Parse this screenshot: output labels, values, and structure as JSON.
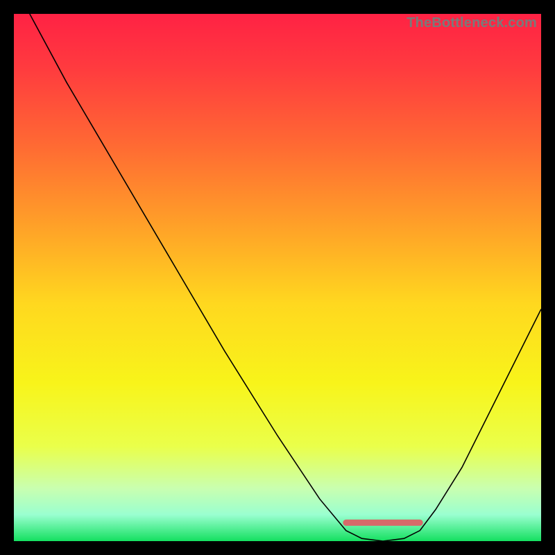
{
  "watermark": "TheBottleneck.com",
  "chart_data": {
    "type": "line",
    "title": "",
    "xlabel": "",
    "ylabel": "",
    "xlim": [
      0,
      100
    ],
    "ylim": [
      0,
      100
    ],
    "grid": false,
    "legend": false,
    "background_gradient": {
      "stops": [
        {
          "offset": 0.0,
          "color": "#ff2244"
        },
        {
          "offset": 0.1,
          "color": "#ff3a3f"
        },
        {
          "offset": 0.25,
          "color": "#ff6a33"
        },
        {
          "offset": 0.4,
          "color": "#ffa028"
        },
        {
          "offset": 0.55,
          "color": "#ffd81f"
        },
        {
          "offset": 0.7,
          "color": "#f8f41a"
        },
        {
          "offset": 0.82,
          "color": "#eaff4a"
        },
        {
          "offset": 0.9,
          "color": "#c9ffb0"
        },
        {
          "offset": 0.95,
          "color": "#9affd0"
        },
        {
          "offset": 1.0,
          "color": "#14e060"
        }
      ]
    },
    "series": [
      {
        "name": "bottleneck-curve",
        "color": "#000000",
        "width": 1.6,
        "x": [
          3,
          10,
          20,
          30,
          40,
          50,
          58,
          63,
          66,
          70,
          74,
          77,
          80,
          85,
          90,
          95,
          100
        ],
        "y": [
          100,
          87,
          70,
          53,
          36,
          20,
          8,
          2,
          0.5,
          0,
          0.5,
          2,
          6,
          14,
          24,
          34,
          44
        ]
      }
    ],
    "annotations": [
      {
        "name": "optimal-zone-marker",
        "type": "segment",
        "color": "#d76a6a",
        "width": 9,
        "linecap": "round",
        "x0": 63,
        "y0": 3.5,
        "x1": 77,
        "y1": 3.5
      }
    ]
  }
}
